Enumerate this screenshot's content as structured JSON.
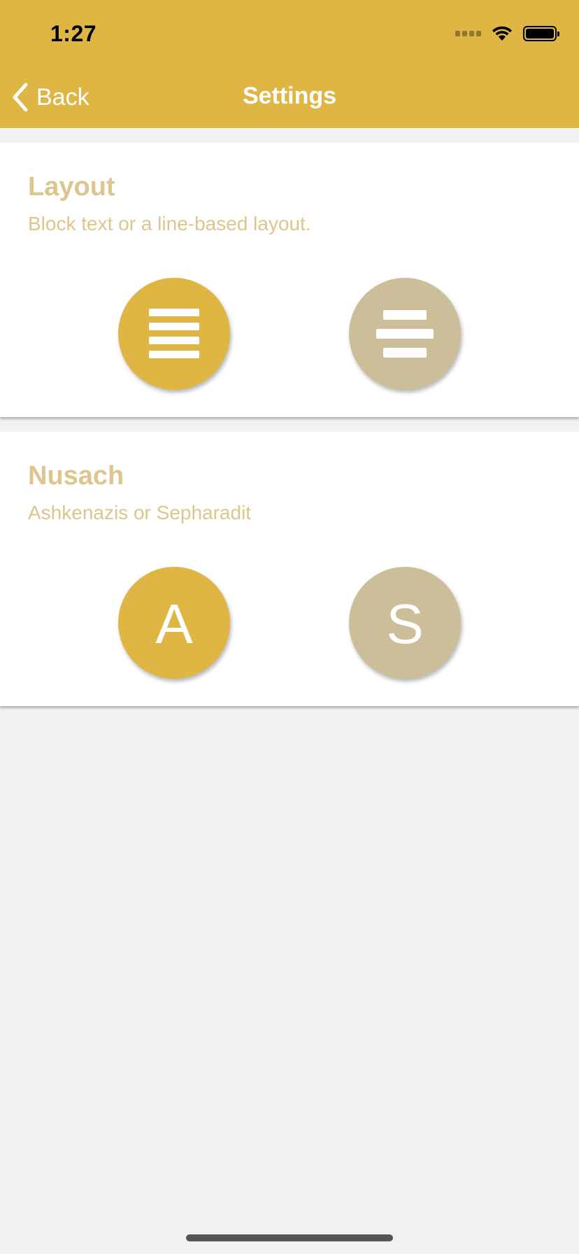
{
  "status_bar": {
    "time": "1:27"
  },
  "nav": {
    "back_label": "Back",
    "title": "Settings"
  },
  "sections": {
    "layout": {
      "title": "Layout",
      "subtitle": "Block text or a line-based layout.",
      "options": [
        "block-text-icon",
        "line-based-icon"
      ]
    },
    "nusach": {
      "title": "Nusach",
      "subtitle": "Ashkenazis or Sepharadit",
      "options": {
        "ashkenazis": "A",
        "sepharadit": "S"
      }
    }
  },
  "colors": {
    "accent": "#dfb643",
    "inactive": "#cbbe98",
    "heading_text": "#dcc68d",
    "background": "#f1f1f1"
  }
}
